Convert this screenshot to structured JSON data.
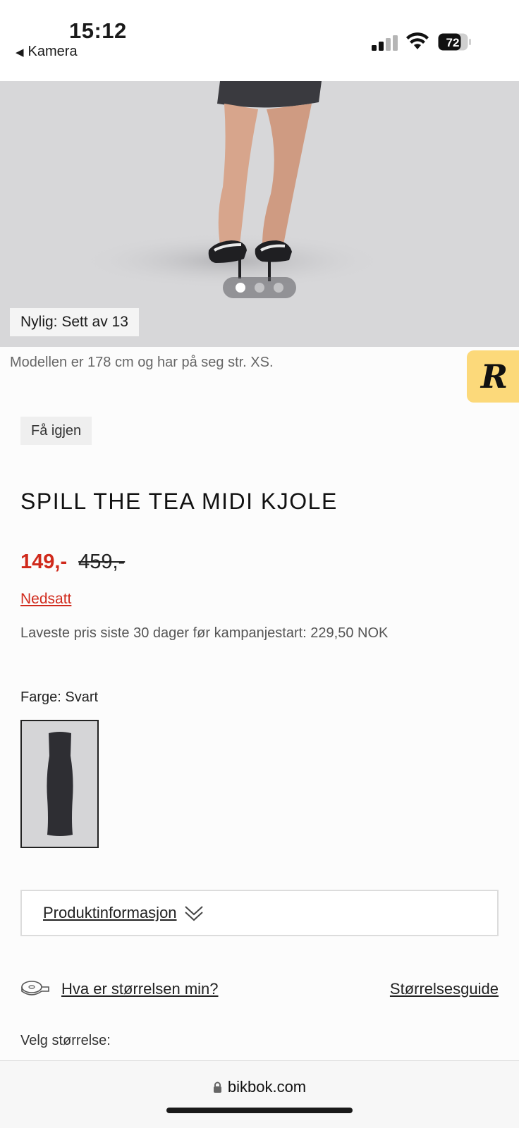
{
  "status_bar": {
    "time": "15:12",
    "back_label": "Kamera",
    "battery": "72"
  },
  "hero": {
    "recent_badge": "Nylig: Sett av 13",
    "dots_total": 3,
    "dots_active": 1
  },
  "model_info": "Modellen er 178 cm og har på seg str. XS.",
  "floating_badge": "R",
  "tag": "Få igjen",
  "product": {
    "title": "SPILL THE TEA MIDI KJOLE",
    "price_now": "149,-",
    "price_old": "459,-",
    "discount_link": "Nedsatt",
    "lowest_price_note": "Laveste pris siste 30 dager før kampanjestart: 229,50 NOK",
    "color_label": "Farge: Svart"
  },
  "accordion": {
    "label": "Produktinformasjon"
  },
  "size": {
    "question": "Hva er størrelsen min?",
    "guide": "Størrelsesguide",
    "choose_label": "Velg størrelse:"
  },
  "browser": {
    "url": "bikbok.com"
  },
  "colors": {
    "sale_red": "#d02a1c",
    "badge_yellow": "#fcd97a",
    "hero_bg": "#d7d7d9"
  }
}
